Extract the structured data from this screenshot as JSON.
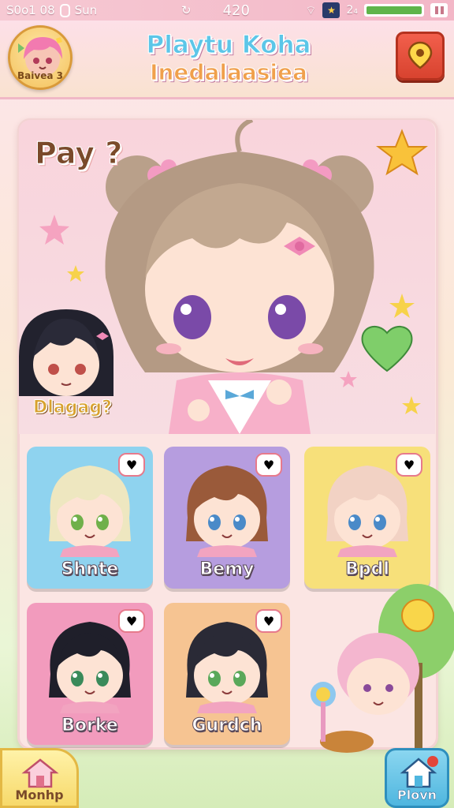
{
  "status_bar": {
    "left_text": "S0o1 08",
    "day": "Sun",
    "center_value": "420",
    "right_value": "2₄",
    "battery_level": 1.0,
    "colors": {
      "bar": "#f3b7c7",
      "battery_fill": "#5fb44a"
    }
  },
  "header": {
    "player_badge_label": "Baivea 3",
    "title_line1": "Playtu Koha",
    "title_line2": "Inedalaasiea",
    "map_button_icon": "map-pin-icon"
  },
  "hero": {
    "question": "Pay ?",
    "side_character_label": "Dlagag?"
  },
  "characters": [
    {
      "name": "Shnte",
      "color": "#8fd3ef",
      "hair": "#eee7c0",
      "eyes": "#6fb04a"
    },
    {
      "name": "Bemy",
      "color": "#b69ddf",
      "hair": "#9a5a3a",
      "eyes": "#4a8ac8"
    },
    {
      "name": "Bpdl",
      "color": "#f7e07a",
      "hair": "#f2d2c4",
      "eyes": "#4a8ac8"
    },
    {
      "name": "Borke",
      "color": "#f29bbd",
      "hair": "#1f1f2a",
      "eyes": "#3a8a5a"
    },
    {
      "name": "Gurdch",
      "color": "#f6c492",
      "hair": "#2a2a36",
      "eyes": "#5aa85a"
    }
  ],
  "bottom_nav": {
    "left_label": "Monhp",
    "left_icon": "home-icon",
    "right_label": "Plovn",
    "right_icon": "house-notification-icon"
  }
}
